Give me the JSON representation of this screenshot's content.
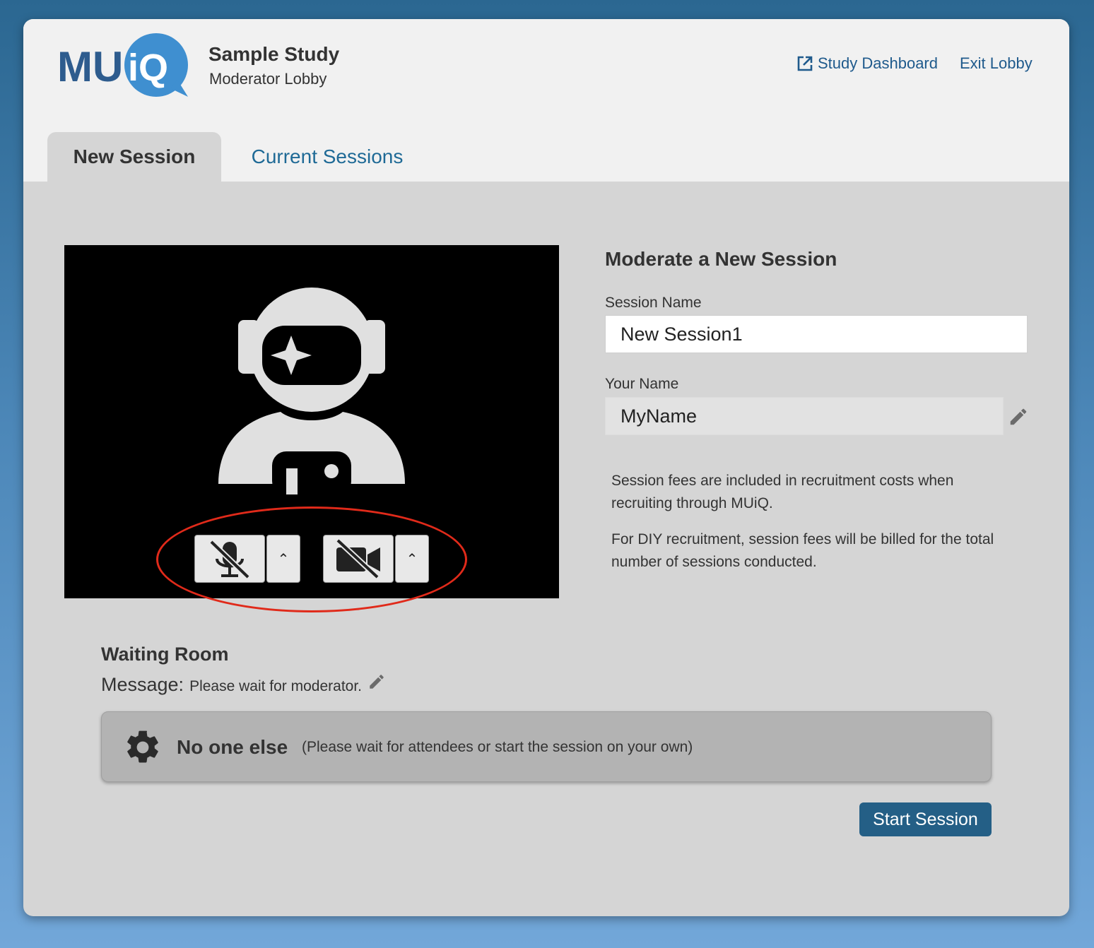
{
  "header": {
    "logo_text": "MUiQ",
    "study_title": "Sample Study",
    "study_subtitle": "Moderator Lobby",
    "dashboard_link": "Study Dashboard",
    "exit_link": "Exit Lobby"
  },
  "tabs": [
    {
      "label": "New Session",
      "active": true
    },
    {
      "label": "Current Sessions",
      "active": false
    }
  ],
  "video": {
    "mic_icon": "mic-muted-icon",
    "camera_icon": "camera-off-icon",
    "caret_icon": "chevron-up-icon"
  },
  "form": {
    "title": "Moderate a New Session",
    "session_name_label": "Session Name",
    "session_name_value": "New Session1",
    "your_name_label": "Your Name",
    "your_name_value": "MyName",
    "fee_note_1": "Session fees are included in recruitment costs when recruiting through MUiQ.",
    "fee_note_2": "For DIY recruitment, session fees will be billed for the total number of sessions conducted."
  },
  "waiting_room": {
    "title": "Waiting Room",
    "message_label": "Message:",
    "message_text": "Please wait for moderator.",
    "empty_title": "No one else",
    "empty_hint": "(Please wait for attendees or start the session on your own)"
  },
  "actions": {
    "start_session": "Start Session"
  },
  "colors": {
    "accent": "#245f86",
    "link": "#1f5a8c",
    "highlight_oval": "#e02a1a"
  }
}
